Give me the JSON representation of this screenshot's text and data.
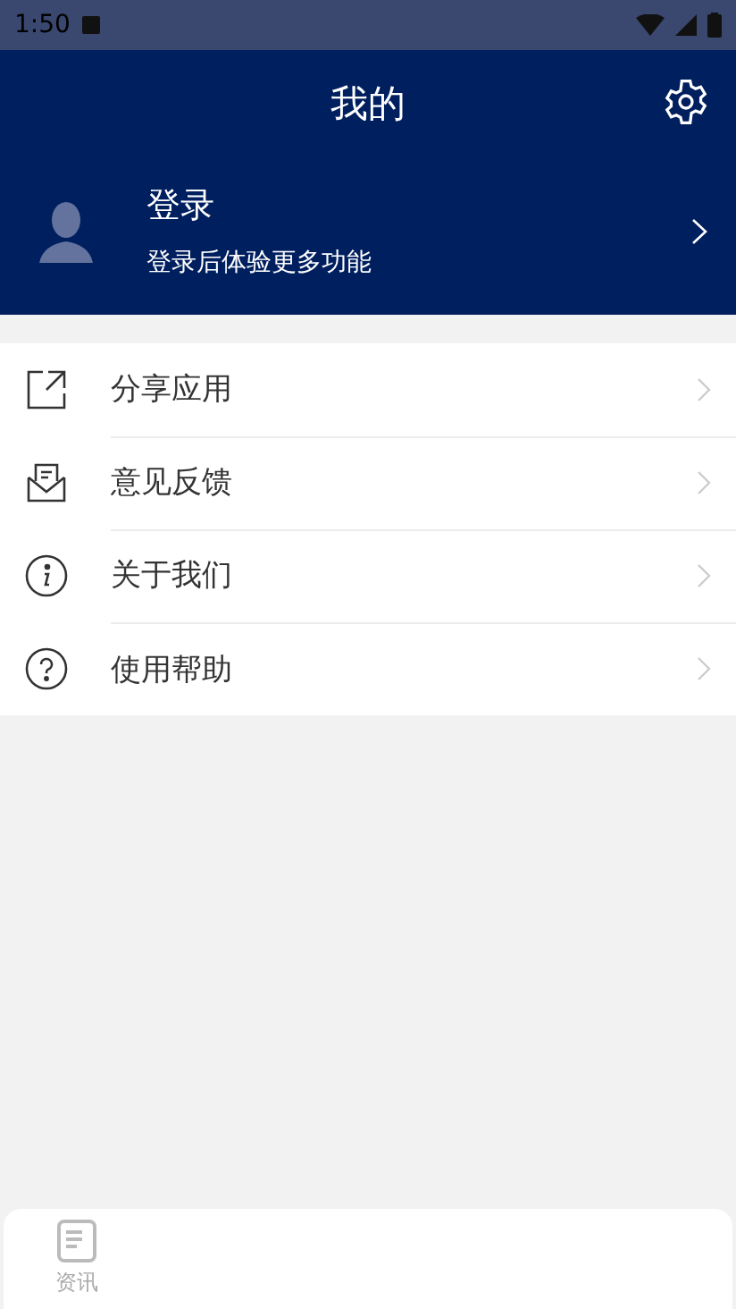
{
  "status_bar": {
    "time": "1:50"
  },
  "header": {
    "title": "我的"
  },
  "profile": {
    "name": "登录",
    "subtitle": "登录后体验更多功能"
  },
  "menu": [
    {
      "kind": "share",
      "label": "分享应用"
    },
    {
      "kind": "feedback",
      "label": "意见反馈"
    },
    {
      "kind": "about",
      "label": "关于我们"
    },
    {
      "kind": "help",
      "label": "使用帮助"
    }
  ],
  "tab_bar": [
    {
      "label": "资讯",
      "selected": false
    }
  ]
}
